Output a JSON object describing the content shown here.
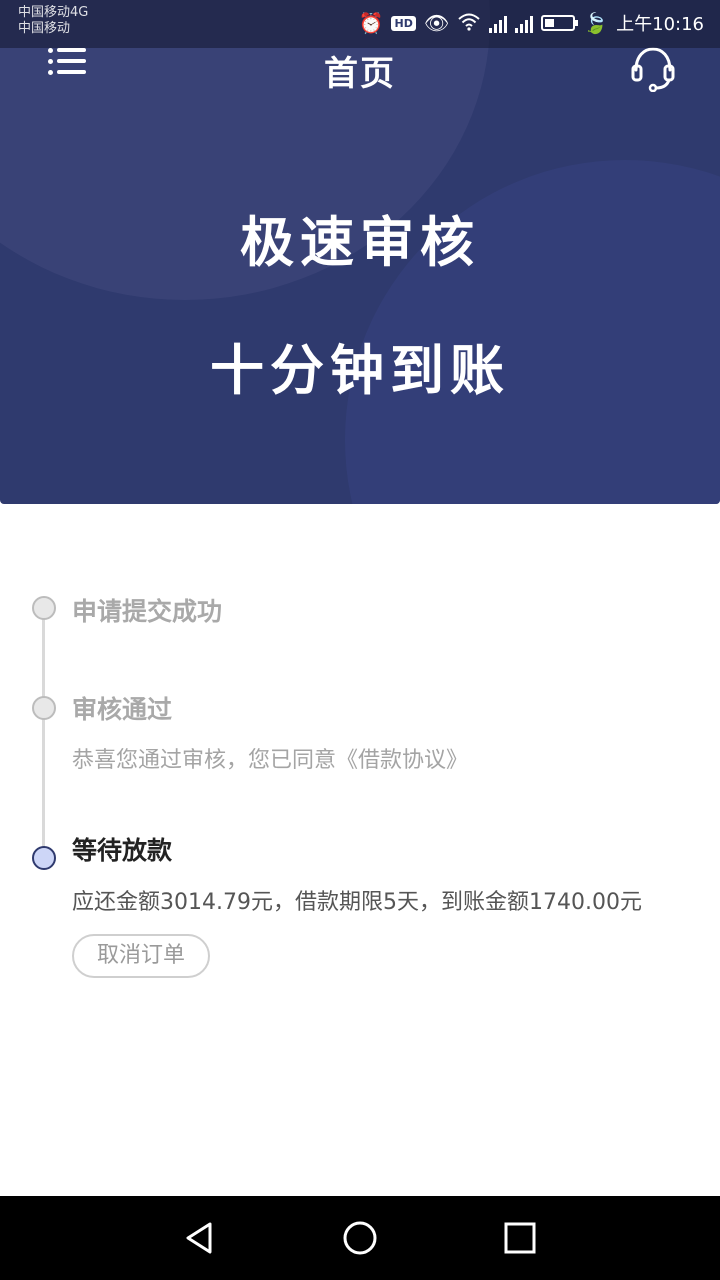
{
  "status_bar": {
    "carrier_1": "中国移动4G",
    "carrier_2": "中国移动",
    "time": "上午10:16",
    "battery_level": 0.35
  },
  "header": {
    "title": "首页",
    "slogan_line1": "极速审核",
    "slogan_line2": "十分钟到账"
  },
  "icons": {
    "menu": "menu-icon",
    "customer_service": "headset-icon"
  },
  "steps": [
    {
      "title": "申请提交成功",
      "desc": "",
      "state": "done"
    },
    {
      "title": "审核通过",
      "desc": "恭喜您通过审核，您已同意《借款协议》",
      "state": "done"
    },
    {
      "title": "等待放款",
      "desc": "应还金额3014.79元，借款期限5天，到账金额1740.00元",
      "state": "current"
    }
  ],
  "actions": {
    "cancel_label": "取消订单"
  },
  "colors": {
    "primary": "#2f3a6e",
    "active_dot": "#cdd6f7",
    "inactive_text": "#a9a9a9"
  }
}
